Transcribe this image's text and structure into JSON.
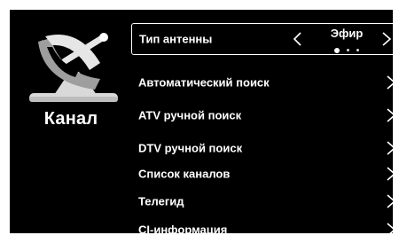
{
  "sidebar": {
    "icon": "satellite-dish-icon",
    "title": "Канал"
  },
  "menu": {
    "selected_index": 0,
    "items": [
      {
        "label": "Тип антенны",
        "value": "Эфир",
        "option_count": 3,
        "option_index": 0
      },
      {
        "label": "Автоматический поиск"
      },
      {
        "label": "ATV ручной поиск"
      },
      {
        "label": "DTV ручной поиск"
      },
      {
        "label": "Список каналов"
      },
      {
        "label": "Телегид"
      },
      {
        "label": "CI-информация"
      }
    ]
  },
  "colors": {
    "background": "#000000",
    "foreground": "#ffffff",
    "frame": "#ffffff"
  }
}
